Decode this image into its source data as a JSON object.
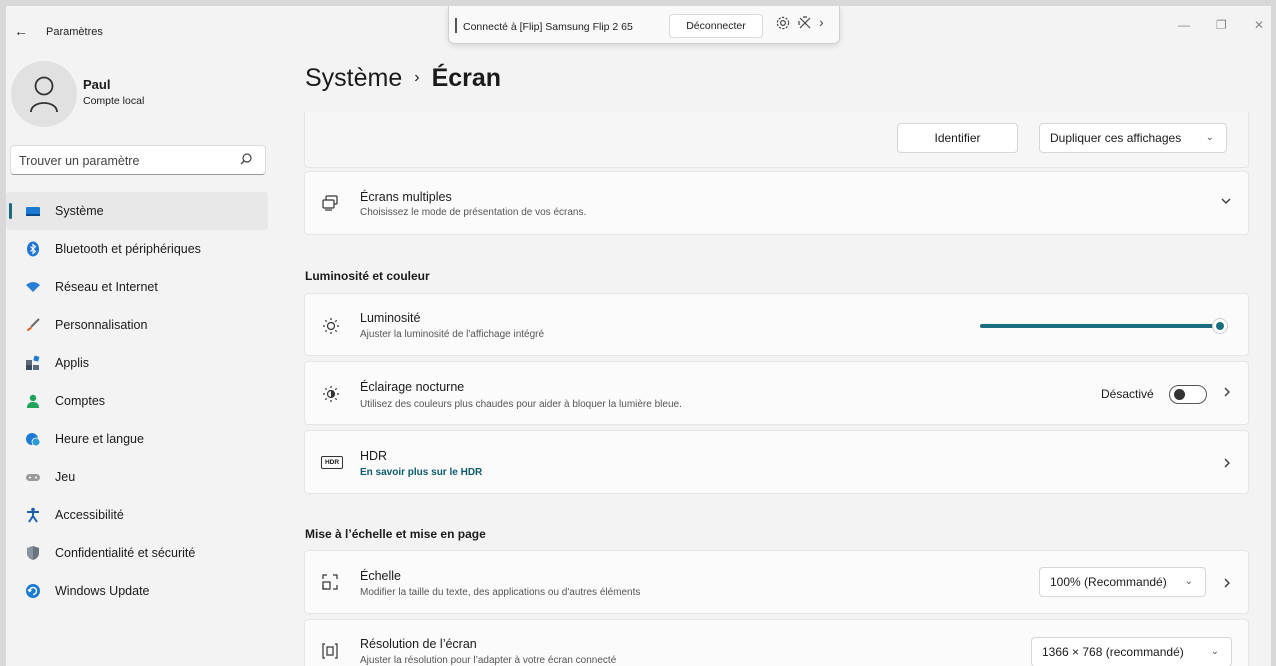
{
  "window": {
    "back_glyph": "←",
    "title": "Paramètres",
    "minimize_glyph": "—",
    "maximize_glyph": "❐",
    "close_glyph": "✕"
  },
  "castbar": {
    "text": "Connecté à [Flip] Samsung Flip 2 65",
    "disconnect_label": "Déconnecter",
    "settings_icon": "gear-icon",
    "pin_icon": "pin-icon",
    "expand_glyph": "›"
  },
  "profile": {
    "name": "Paul",
    "account_type": "Compte local"
  },
  "search": {
    "placeholder": "Trouver un paramètre"
  },
  "sidebar": {
    "items": [
      {
        "label": "Système",
        "icon": "monitor-icon",
        "color": "#1a7ad4",
        "active": true
      },
      {
        "label": "Bluetooth et périphériques",
        "icon": "bluetooth-icon",
        "color": "#1e74d6"
      },
      {
        "label": "Réseau et Internet",
        "icon": "wifi-icon",
        "color": "#2a7ed6"
      },
      {
        "label": "Personnalisation",
        "icon": "brush-icon",
        "color": "#d86a2a"
      },
      {
        "label": "Applis",
        "icon": "apps-icon",
        "color": "#5a6a7a"
      },
      {
        "label": "Comptes",
        "icon": "person-icon",
        "color": "#1fa35a"
      },
      {
        "label": "Heure et langue",
        "icon": "globe-clock-icon",
        "color": "#1a7ad4"
      },
      {
        "label": "Jeu",
        "icon": "gamepad-icon",
        "color": "#8a8a8a"
      },
      {
        "label": "Accessibilité",
        "icon": "accessibility-icon",
        "color": "#1a5fb4"
      },
      {
        "label": "Confidentialité et sécurité",
        "icon": "shield-icon",
        "color": "#6a7480"
      },
      {
        "label": "Windows Update",
        "icon": "update-icon",
        "color": "#1a7ad4"
      }
    ]
  },
  "breadcrumb": {
    "parent": "Système",
    "separator": "›",
    "current": "Écran"
  },
  "top_card": {
    "identify_label": "Identifier",
    "duplicate_label": "Dupliquer ces affichages"
  },
  "multi_displays": {
    "title": "Écrans multiples",
    "subtitle": "Choisissez le mode de présentation de vos écrans."
  },
  "section_brightness": "Luminosité et couleur",
  "brightness": {
    "title": "Luminosité",
    "subtitle": "Ajuster la luminosité de l'affichage intégré",
    "value_fraction": 1.0
  },
  "night_light": {
    "title": "Éclairage nocturne",
    "subtitle": "Utilisez des couleurs plus chaudes pour aider à bloquer la lumière bleue.",
    "status": "Désactivé",
    "on": false
  },
  "hdr": {
    "title": "HDR",
    "link": "En savoir plus sur le HDR",
    "badge": "HDR"
  },
  "section_scale": "Mise à l’échelle et mise en page",
  "scale": {
    "title": "Échelle",
    "subtitle": "Modifier la taille du texte, des applications ou d'autres éléments",
    "value": "100% (Recommandé)"
  },
  "resolution": {
    "title": "Résolution de l’écran",
    "subtitle": "Ajuster la résolution pour l’adapter à  votre  écran connecté",
    "value": "1366 × 768 (recommandé)"
  },
  "colors": {
    "accent": "#1a6d7e",
    "link": "#0b5a6e"
  }
}
